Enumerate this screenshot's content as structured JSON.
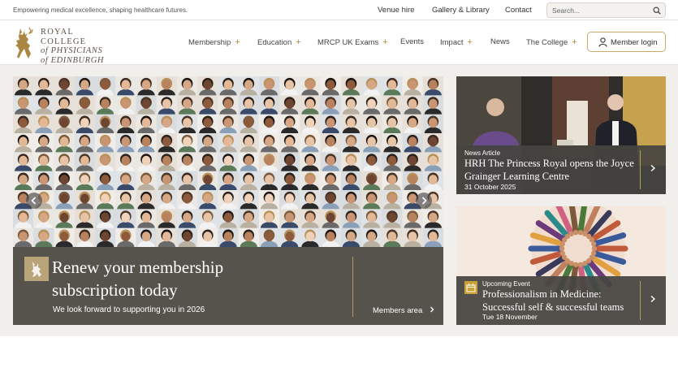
{
  "topbar": {
    "tagline": "Empowering medical excellence, shaping healthcare futures.",
    "links": [
      "Venue hire",
      "Gallery & Library",
      "Contact"
    ],
    "search_placeholder": "Search..."
  },
  "logo": {
    "line1": "ROYAL COLLEGE",
    "line2": "of PHYSICIANS",
    "line3": "of EDINBURGH"
  },
  "nav": {
    "items": [
      {
        "label": "Membership",
        "expandable": true
      },
      {
        "label": "Education",
        "expandable": true
      },
      {
        "label": "MRCP UK Exams",
        "expandable": true
      },
      {
        "label": "Events",
        "expandable": false
      },
      {
        "label": "Impact",
        "expandable": true
      },
      {
        "label": "News",
        "expandable": false
      },
      {
        "label": "The College",
        "expandable": true
      }
    ],
    "plus_symbol": "+",
    "login_label": "Member login"
  },
  "hero": {
    "title": "Renew your membership subscription today",
    "subtitle": "We look forward to supporting you in 2026",
    "cta": "Members area"
  },
  "cards": [
    {
      "type": "News Article",
      "title": "HRH The Princess Royal opens the Joyce Grainger Learning Centre",
      "date": "31 October 2025"
    },
    {
      "type": "Upcoming Event",
      "title": "Professionalism in Medicine: Successful self & successful teams",
      "date": "Tue 18 November"
    }
  ],
  "colors": {
    "accent_gold": "#b38a3c",
    "panel_dark": "#56534d",
    "stage_bg": "#f1efec"
  },
  "icons": [
    "search-icon",
    "user-icon",
    "chevron-right-icon",
    "chevron-left-icon",
    "calendar-icon",
    "crest-icon",
    "stag-logo-icon"
  ]
}
